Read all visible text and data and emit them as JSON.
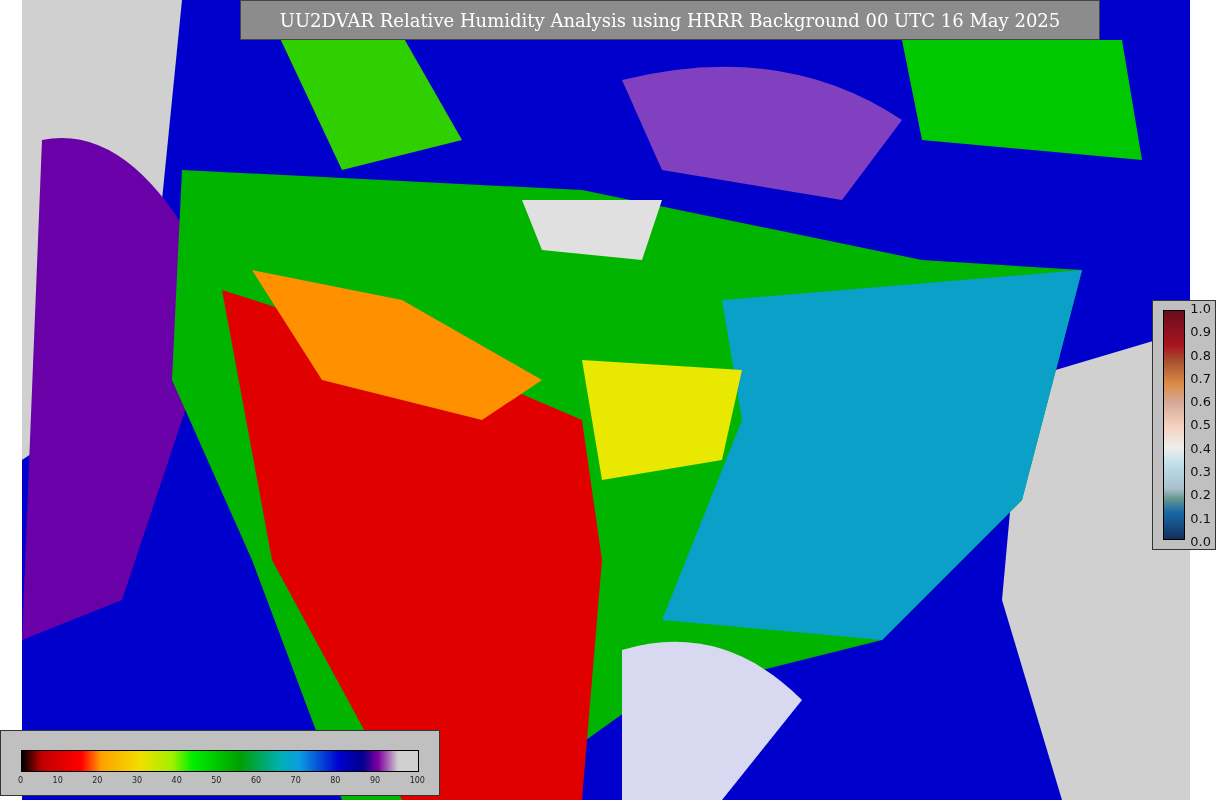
{
  "title": "UU2DVAR Relative Humidity Analysis using HRRR Background 00 UTC 16 May 2025",
  "observation_legend": {
    "labels": [
      "1.0",
      "0.9",
      "0.8",
      "0.7",
      "0.6",
      "0.5",
      "0.4",
      "0.3",
      "0.2",
      "0.1",
      "0.0"
    ]
  },
  "humidity_legend": {
    "labels": [
      "0",
      "10",
      "20",
      "30",
      "40",
      "50",
      "60",
      "70",
      "80",
      "90",
      "100"
    ]
  }
}
